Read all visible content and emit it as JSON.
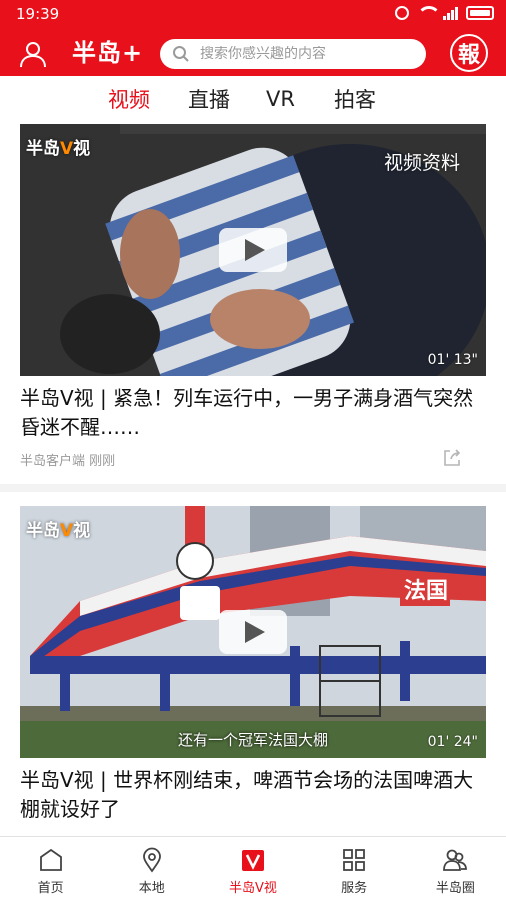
{
  "status_bar": {
    "time": "19:39"
  },
  "header": {
    "logo_text": "半岛+",
    "search_placeholder": "搜索你感兴趣的内容",
    "newspaper_button": "報"
  },
  "tabs": [
    {
      "label": "视频",
      "active": true
    },
    {
      "label": "直播",
      "active": false
    },
    {
      "label": "VR",
      "active": false
    },
    {
      "label": "拍客",
      "active": false
    }
  ],
  "feed": [
    {
      "watermark_prefix": "半岛",
      "watermark_v": "V",
      "watermark_suffix": "视",
      "overlay_tag": "视频资料",
      "duration": "01' 13\"",
      "title": "半岛V视 | 紧急！列车运行中，一男子满身酒气突然昏迷不醒……",
      "source": "半岛客户端",
      "time": "刚刚"
    },
    {
      "watermark_prefix": "半岛",
      "watermark_v": "V",
      "watermark_suffix": "视",
      "caption": "还有一个冠军法国大棚",
      "duration": "01' 24\"",
      "title": "半岛V视 | 世界杯刚结束，啤酒节会场的法国啤酒大棚就设好了"
    }
  ],
  "bottom_nav": [
    {
      "label": "首页",
      "icon": "home-icon",
      "active": false
    },
    {
      "label": "本地",
      "icon": "location-icon",
      "active": false
    },
    {
      "label": "半岛V视",
      "icon": "v-video-icon",
      "active": true
    },
    {
      "label": "服务",
      "icon": "grid-icon",
      "active": false
    },
    {
      "label": "半岛圈",
      "icon": "community-icon",
      "active": false
    }
  ],
  "colors": {
    "brand_red": "#e8101a",
    "accent_orange": "#ff8a00"
  }
}
